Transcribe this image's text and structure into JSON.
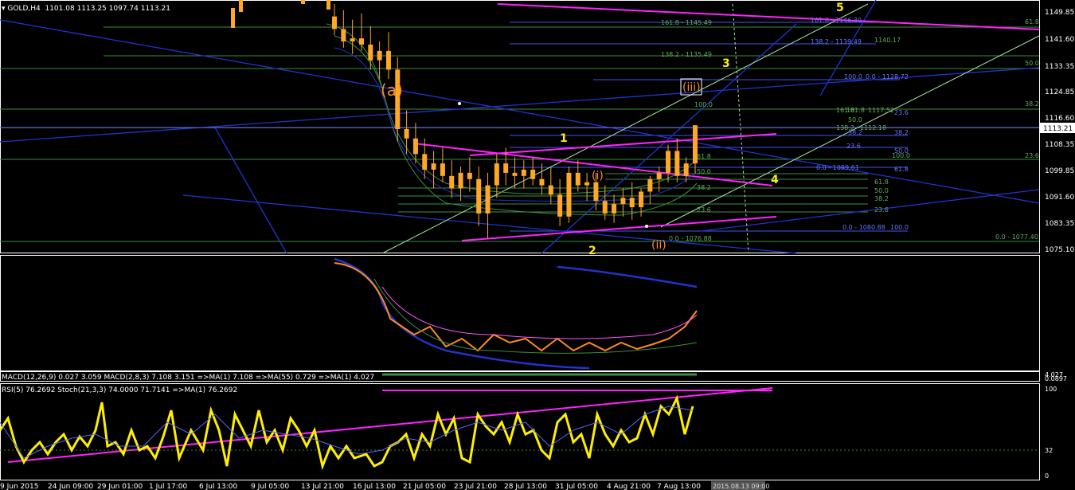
{
  "header": {
    "symbol": "GOLD,H4",
    "ohlc": "1101.08 1113.25 1097.74 1113.21",
    "macd_label": "MACD(12,26,9) 0.027  3.059  MACD(2,8,3) 7.108  3.151  =>MA(1) 7.108  =>MA(55) 0.729  =>MA(1) 4.027",
    "rsi_label": "RSI(5) 76.2692  Stoch(21,3,3) 74.0000  71.7141  =>MA(1) 76.2692"
  },
  "colors": {
    "background": "#000000",
    "grid": "#1e4d1e",
    "bull_candle": "#ffa726",
    "bear_candle": "#ffa726",
    "trendline_blue": "#2233cc",
    "channel_magenta": "#ff22ff",
    "fib_green": "#3e8e3e",
    "fib_blue": "#4455ee",
    "channel_lightgreen": "#a8e8a8",
    "wave_yellow": "#ffee00",
    "wave_orange": "#ff8c1a",
    "rsi_yellow": "#ffee00"
  },
  "price_axis": {
    "ticks": [
      "1149.85",
      "1141.60",
      "1133.35",
      "1124.85",
      "1116.60",
      "1108.35",
      "1099.85",
      "1091.60",
      "1083.35",
      "1075.10"
    ],
    "current": "1113.21"
  },
  "time_axis": {
    "ticks": [
      "9 Jun 2015",
      "24 Jun 09:00",
      "29 Jun 01:00",
      "1 Jul 17:00",
      "6 Jul 13:00",
      "9 Jul 05:00",
      "13 Jul 21:00",
      "16 Jul 13:00",
      "21 Jul 05:00",
      "23 Jul 21:00",
      "28 Jul 13:00",
      "31 Jul 05:00",
      "4 Aug 21:00",
      "7 Aug 13:00"
    ],
    "highlight": "2015.08.13 09:00"
  },
  "waves": {
    "primary": [
      "1",
      "2",
      "3",
      "4",
      "5"
    ],
    "intermediate": [
      "(a)"
    ],
    "minor": [
      "(i)",
      "(ii)",
      "(iii)"
    ]
  },
  "fib_labels": {
    "green": [
      "161.8 - 1145.49",
      "138.2 - 1135.49",
      "100.0",
      "61.8",
      "50.0",
      "38.2",
      "23.6",
      "0.0 - 1076.88",
      "0.0 - 1077.40",
      "61.8",
      "50.0",
      "38.2",
      "23.6",
      "100.0",
      "61.8",
      "50.0",
      "38.2",
      "23.6",
      "1140.17",
      "1117.52",
      "1112.18",
      "161.8",
      "138.2",
      "161.8",
      "50.0"
    ],
    "blue": [
      "161.8 - 1146.30",
      "138.2 - 1139.49",
      "100.0",
      "0.0 - 1128.72",
      "38.2",
      "23.6",
      "0.0 - 1099.61",
      "0.0 - 1080.88",
      "100.0",
      "23.6",
      "38.2",
      "50.0",
      "61.8"
    ]
  },
  "indicator_axes": {
    "macd": [
      "4.027",
      "0.0897"
    ],
    "rsi": [
      "100",
      "32",
      "0"
    ]
  },
  "chart_data": {
    "type": "candlestick",
    "title": "GOLD,H4",
    "x_range": [
      "2015-06-09",
      "2015-08-13 09:00"
    ],
    "ylim": [
      1073,
      1152
    ],
    "candles": [
      {
        "o": 1148,
        "h": 1152,
        "l": 1142,
        "c": 1144
      },
      {
        "o": 1144,
        "h": 1150,
        "l": 1138,
        "c": 1140
      },
      {
        "o": 1140,
        "h": 1147,
        "l": 1136,
        "c": 1141
      },
      {
        "o": 1141,
        "h": 1149,
        "l": 1137,
        "c": 1139
      },
      {
        "o": 1139,
        "h": 1145,
        "l": 1131,
        "c": 1134
      },
      {
        "o": 1134,
        "h": 1140,
        "l": 1128,
        "c": 1137
      },
      {
        "o": 1137,
        "h": 1143,
        "l": 1128,
        "c": 1131
      },
      {
        "o": 1131,
        "h": 1135,
        "l": 1108,
        "c": 1112
      },
      {
        "o": 1112,
        "h": 1118,
        "l": 1104,
        "c": 1109
      },
      {
        "o": 1109,
        "h": 1114,
        "l": 1101,
        "c": 1104
      },
      {
        "o": 1104,
        "h": 1109,
        "l": 1096,
        "c": 1099
      },
      {
        "o": 1099,
        "h": 1105,
        "l": 1093,
        "c": 1101
      },
      {
        "o": 1101,
        "h": 1106,
        "l": 1095,
        "c": 1097
      },
      {
        "o": 1097,
        "h": 1102,
        "l": 1090,
        "c": 1093
      },
      {
        "o": 1093,
        "h": 1100,
        "l": 1089,
        "c": 1098
      },
      {
        "o": 1098,
        "h": 1103,
        "l": 1092,
        "c": 1096
      },
      {
        "o": 1096,
        "h": 1100,
        "l": 1081,
        "c": 1085
      },
      {
        "o": 1085,
        "h": 1098,
        "l": 1077,
        "c": 1094
      },
      {
        "o": 1094,
        "h": 1104,
        "l": 1090,
        "c": 1101
      },
      {
        "o": 1101,
        "h": 1106,
        "l": 1094,
        "c": 1098
      },
      {
        "o": 1098,
        "h": 1103,
        "l": 1093,
        "c": 1097
      },
      {
        "o": 1097,
        "h": 1102,
        "l": 1093,
        "c": 1099
      },
      {
        "o": 1099,
        "h": 1103,
        "l": 1094,
        "c": 1096
      },
      {
        "o": 1096,
        "h": 1101,
        "l": 1091,
        "c": 1094
      },
      {
        "o": 1094,
        "h": 1100,
        "l": 1088,
        "c": 1091
      },
      {
        "o": 1091,
        "h": 1096,
        "l": 1081,
        "c": 1084
      },
      {
        "o": 1084,
        "h": 1100,
        "l": 1082,
        "c": 1098
      },
      {
        "o": 1098,
        "h": 1102,
        "l": 1092,
        "c": 1094
      },
      {
        "o": 1094,
        "h": 1098,
        "l": 1089,
        "c": 1095
      },
      {
        "o": 1095,
        "h": 1098,
        "l": 1086,
        "c": 1089
      },
      {
        "o": 1089,
        "h": 1094,
        "l": 1083,
        "c": 1085
      },
      {
        "o": 1085,
        "h": 1091,
        "l": 1082,
        "c": 1088
      },
      {
        "o": 1088,
        "h": 1093,
        "l": 1084,
        "c": 1090
      },
      {
        "o": 1090,
        "h": 1095,
        "l": 1083,
        "c": 1087
      },
      {
        "o": 1087,
        "h": 1093,
        "l": 1084,
        "c": 1092
      },
      {
        "o": 1092,
        "h": 1097,
        "l": 1088,
        "c": 1096
      },
      {
        "o": 1096,
        "h": 1100,
        "l": 1092,
        "c": 1098
      },
      {
        "o": 1098,
        "h": 1107,
        "l": 1095,
        "c": 1105
      },
      {
        "o": 1105,
        "h": 1109,
        "l": 1095,
        "c": 1097
      },
      {
        "o": 1097,
        "h": 1103,
        "l": 1095,
        "c": 1101
      },
      {
        "o": 1101,
        "h": 1113.25,
        "l": 1097.74,
        "c": 1113.21
      }
    ]
  }
}
